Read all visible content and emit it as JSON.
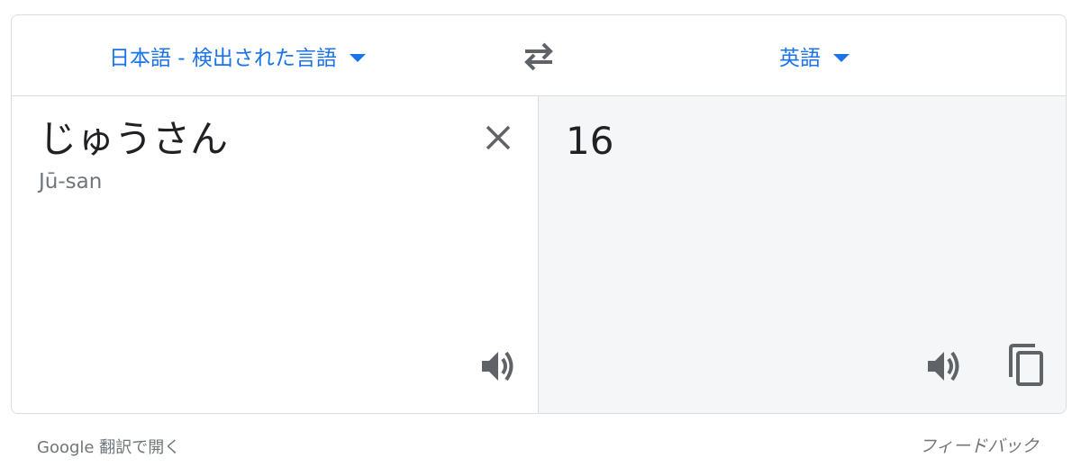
{
  "translate": {
    "source_language": "日本語 - 検出された言語",
    "target_language": "英語",
    "source_text": "じゅうさん",
    "romanization": "Jū-san",
    "translated_text": "16"
  },
  "footer": {
    "open_in_google_translate": "Google 翻訳で開く",
    "feedback": "フィードバック"
  },
  "colors": {
    "accent": "#1a73e8",
    "icon": "#5f6368",
    "target_panel_bg": "#f5f6f8",
    "border": "#dadce0"
  },
  "icons": {
    "swap": "swap-horiz-icon",
    "clear": "close-icon",
    "listen": "speaker-icon",
    "copy": "copy-icon"
  }
}
